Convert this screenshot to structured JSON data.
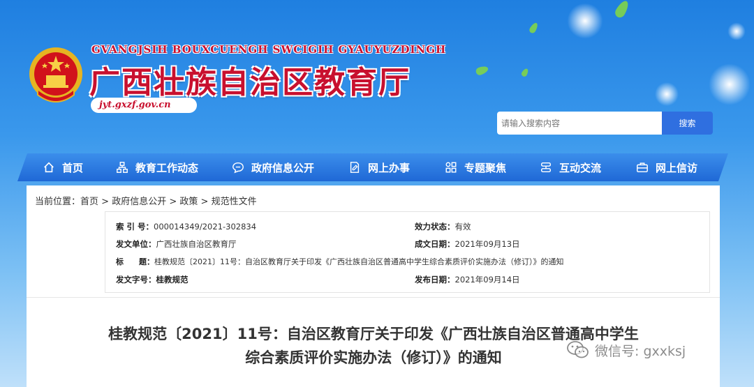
{
  "header": {
    "roman_name": "GVANGJSIH BOUXCUENGH SWCIGIH GYAUYUZDINGH",
    "title": "广西壮族自治区教育厅",
    "domain": "jyt.gxzf.gov.cn"
  },
  "search": {
    "placeholder": "请输入搜索内容",
    "button_label": "搜索"
  },
  "nav": {
    "items": [
      {
        "label": "首页",
        "icon": "home-icon"
      },
      {
        "label": "教育工作动态",
        "icon": "sitemap-icon"
      },
      {
        "label": "政府信息公开",
        "icon": "chat-icon"
      },
      {
        "label": "网上办事",
        "icon": "edit-document-icon"
      },
      {
        "label": "专题聚焦",
        "icon": "grid-icon"
      },
      {
        "label": "互动交流",
        "icon": "server-icon"
      },
      {
        "label": "网上信访",
        "icon": "briefcase-icon"
      }
    ]
  },
  "breadcrumb": {
    "prefix": "当前位置：",
    "items": [
      "首页",
      "政府信息公开",
      "政策",
      "规范性文件"
    ],
    "separator": " > "
  },
  "meta": {
    "index_label": "索 引 号：",
    "index_value": "000014349/2021-302834",
    "status_label": "效力状态：",
    "status_value": "有效",
    "issuer_label": "发文单位：",
    "issuer_value": "广西壮族自治区教育厅",
    "created_label": "成文日期：",
    "created_value": "2021年09月13日",
    "title_label": "标　　题：",
    "title_value": "桂教规范〔2021〕11号：自治区教育厅关于印发《广西壮族自治区普通高中学生综合素质评价实施办法（修订）》的通知",
    "docno_label": "发文字号：",
    "docno_value": "桂教规范",
    "published_label": "发布日期：",
    "published_value": "2021年09月14日"
  },
  "document": {
    "title_line1": "桂教规范〔2021〕11号：自治区教育厅关于印发《广西壮族自治区普通高中学生",
    "title_line2": "综合素质评价实施办法（修订）》的通知"
  },
  "watermark": {
    "text": "微信号: gxxksj"
  }
}
